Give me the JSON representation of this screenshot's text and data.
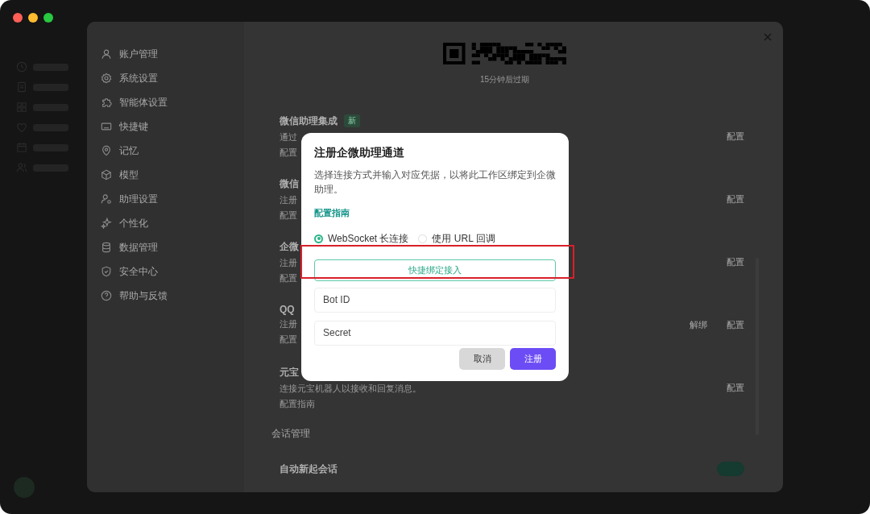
{
  "settings": {
    "nav": [
      {
        "label": "账户管理"
      },
      {
        "label": "系统设置"
      },
      {
        "label": "智能体设置"
      },
      {
        "label": "快捷键"
      },
      {
        "label": "记忆"
      },
      {
        "label": "模型"
      },
      {
        "label": "助理设置"
      },
      {
        "label": "个性化"
      },
      {
        "label": "数据管理"
      },
      {
        "label": "安全中心"
      },
      {
        "label": "帮助与反馈"
      }
    ],
    "qr_caption": "15分钟后过期",
    "integrations": [
      {
        "title": "微信助理集成",
        "badge": "新",
        "description": "通过",
        "link": "配置",
        "actions": [
          "配置"
        ]
      },
      {
        "title": "微信",
        "description": "注册",
        "link": "配置",
        "actions": [
          "配置"
        ]
      },
      {
        "title": "企微",
        "description": "注册",
        "link": "配置",
        "actions": [
          "配置"
        ]
      },
      {
        "title": "QQ",
        "description": "注册",
        "link": "配置",
        "actions": [
          "解绑",
          "配置"
        ]
      },
      {
        "title": "元宝",
        "description": "连接元宝机器人以接收和回复消息。",
        "link": "配置指南",
        "actions": [
          "配置"
        ]
      }
    ],
    "section": "会话管理",
    "toggle_row": {
      "label": "自动新起会话",
      "on": true
    }
  },
  "dialog": {
    "title": "注册企微助理通道",
    "description": "选择连接方式并输入对应凭据，以将此工作区绑定到企微助理。",
    "link": "配置指南",
    "options": [
      {
        "label": "WebSocket 长连接",
        "selected": true
      },
      {
        "label": "使用 URL 回调",
        "selected": false
      }
    ],
    "quick_button": "快捷绑定接入",
    "fields": [
      {
        "placeholder": "Bot ID"
      },
      {
        "placeholder": "Secret"
      }
    ],
    "buttons": [
      {
        "label": "取消",
        "kind": "secondary"
      },
      {
        "label": "注册",
        "kind": "primary"
      }
    ]
  }
}
